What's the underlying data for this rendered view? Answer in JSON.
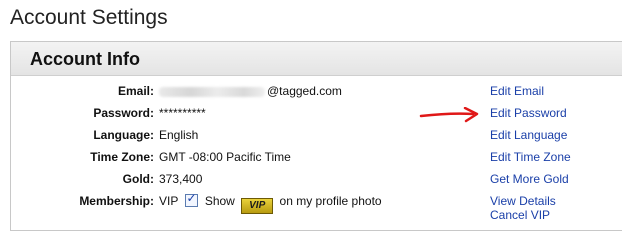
{
  "page": {
    "title": "Account Settings"
  },
  "panel": {
    "title": "Account Info",
    "rows": [
      {
        "label": "Email:",
        "value": "@tagged.com",
        "action": "Edit Email"
      },
      {
        "label": "Password:",
        "value": "**********",
        "action": "Edit Password"
      },
      {
        "label": "Language:",
        "value": "English",
        "action": "Edit Language"
      },
      {
        "label": "Time Zone:",
        "value": "GMT -08:00 Pacific Time",
        "action": "Edit Time Zone"
      },
      {
        "label": "Gold:",
        "value": "373,400",
        "action": "Get More Gold"
      },
      {
        "label": "Membership:",
        "value": "VIP",
        "action": "View Details",
        "action2": "Cancel VIP"
      }
    ],
    "membership": {
      "show_label": "Show",
      "badge_text": "VIP",
      "suffix": "on my profile photo",
      "checked": true
    }
  },
  "colors": {
    "link": "#1a3fa8",
    "arrow": "#e01818"
  },
  "icons": {
    "annotation": "red-arrow-icon",
    "checkbox": "checkbox-checked-icon",
    "badge": "vip-badge-icon"
  }
}
